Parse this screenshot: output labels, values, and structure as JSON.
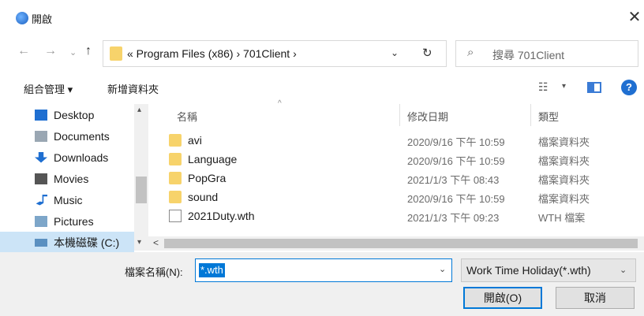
{
  "window": {
    "title": "開啟",
    "close_glyph": "✕"
  },
  "nav": {
    "back_glyph": "←",
    "forward_glyph": "→",
    "recent_glyph": "⌄",
    "up_glyph": "↑",
    "path": "« Program Files (x86)  ›  701Client  ›",
    "dropdown_glyph": "⌄",
    "refresh_glyph": "↻",
    "search_glyph": "⌕",
    "search_placeholder": "搜尋 701Client"
  },
  "toolbar": {
    "organize_label": "組合管理 ▾",
    "new_folder_label": "新增資料夾",
    "view_glyph": "☷",
    "view_dd_glyph": "▾",
    "help_glyph": "?"
  },
  "sidebar": {
    "scroll_up": "▴",
    "scroll_down": "▾",
    "items": [
      {
        "label": "Desktop",
        "icon": "desktop-icon",
        "color": "#1f6fd1"
      },
      {
        "label": "Documents",
        "icon": "documents-icon",
        "color": "#9aa7b3"
      },
      {
        "label": "Downloads",
        "icon": "downloads-icon",
        "color": "#1f6fd1"
      },
      {
        "label": "Movies",
        "icon": "movies-icon",
        "color": "#555555"
      },
      {
        "label": "Music",
        "icon": "music-icon",
        "color": "#1f6fd1"
      },
      {
        "label": "Pictures",
        "icon": "pictures-icon",
        "color": "#7da6c9"
      },
      {
        "label": "本機磁碟 (C:)",
        "icon": "drive-icon",
        "color": "#5a8fc0"
      }
    ]
  },
  "files": {
    "sort_glyph": "^",
    "columns": {
      "name": "名稱",
      "date": "修改日期",
      "type": "類型"
    },
    "rows": [
      {
        "name": "avi",
        "date": "2020/9/16 下午 10:59",
        "type": "檔案資料夾",
        "kind": "folder"
      },
      {
        "name": "Language",
        "date": "2020/9/16 下午 10:59",
        "type": "檔案資料夾",
        "kind": "folder"
      },
      {
        "name": "PopGra",
        "date": "2021/1/3 下午 08:43",
        "type": "檔案資料夾",
        "kind": "folder"
      },
      {
        "name": "sound",
        "date": "2020/9/16 下午 10:59",
        "type": "檔案資料夾",
        "kind": "folder"
      },
      {
        "name": "2021Duty.wth",
        "date": "2021/1/3 下午 09:23",
        "type": "WTH 檔案",
        "kind": "file"
      }
    ]
  },
  "hscroll": {
    "left_glyph": "<",
    "right_glyph": ">"
  },
  "bottom": {
    "filename_label": "檔案名稱(N):",
    "filename_value": "*.wth",
    "filename_dd_glyph": "⌄",
    "filetype_value": "Work Time Holiday(*.wth)",
    "filetype_dd_glyph": "⌄",
    "open_label": "開啟(O)",
    "cancel_label": "取消"
  }
}
